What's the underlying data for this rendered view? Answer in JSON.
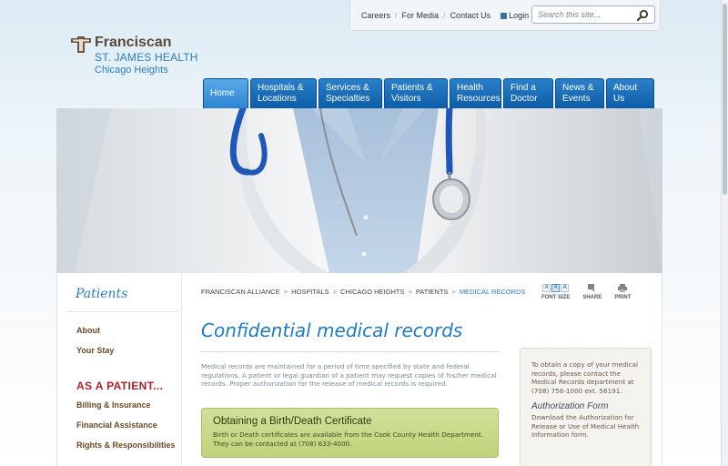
{
  "util": {
    "careers": "Careers",
    "media": "For Media",
    "contact": "Contact Us",
    "login": "Login",
    "search_placeholder": "Search this site..."
  },
  "logo": {
    "line1": "Franciscan",
    "line2": "ST. JAMES HEALTH",
    "line3": "Chicago Heights"
  },
  "nav": {
    "home": "Home",
    "hospitals_1": "Hospitals &",
    "hospitals_2": "Locations",
    "services_1": "Services &",
    "services_2": "Specialties",
    "patients_1": "Patients &",
    "patients_2": "Visitors",
    "health_1": "Health",
    "health_2": "Resources",
    "doctor_1": "Find a",
    "doctor_2": "Doctor",
    "news_1": "News &",
    "news_2": "Events",
    "about_1": "About",
    "about_2": "Us"
  },
  "sidebar": {
    "title": "Patients",
    "about": "About",
    "your_stay": "Your Stay",
    "as_patient": "AS A PATIENT...",
    "billing": "Billing & Insurance",
    "financial": "Financial Assistance",
    "rights": "Rights & Responsibilities"
  },
  "breadcrumb": {
    "b1": "FRANCISCAN ALLIANCE",
    "b2": "HOSPITALS",
    "b3": "CHICAGO HEIGHTS",
    "b4": "PATIENTS",
    "b5": "MEDICAL RECORDS",
    "sep": ">"
  },
  "tools": {
    "font_size": "FONT SIZE",
    "share": "SHARE",
    "print": "PRINT",
    "font_glyph": "A"
  },
  "main": {
    "title": "Confidential medical records",
    "para": "Medical records are maintained for a period of time specified by state and federal regulations. A patient or legal guardian of a patient may request copies of his/her medical records. Proper authorization for the release of medical records is required.",
    "box_title": "Obtaining a Birth/Death Certificate",
    "box_text": "Birth or Death certificates are available from the Cook County Health Department.  They can be contacted at (708) 633-4000."
  },
  "right": {
    "p1": "To obtain a copy of your medical records, please contact the Medical Records department at (708) 756-1000 ext. 56191.",
    "auth_title": "Authorization Form",
    "p2": "Download the Authorization for Release or Use of Medical Health Information form."
  },
  "colors": {
    "nav_blue": "#0d5da8",
    "link_blue": "#2a7ec0",
    "sidebar_brown": "#6b4a26",
    "accent_red": "#b01f2a",
    "green_box": "#c8da88"
  },
  "icons": {
    "search": "magnifier-icon",
    "lock": "lock-icon",
    "share": "share-icon",
    "print": "printer-icon"
  }
}
